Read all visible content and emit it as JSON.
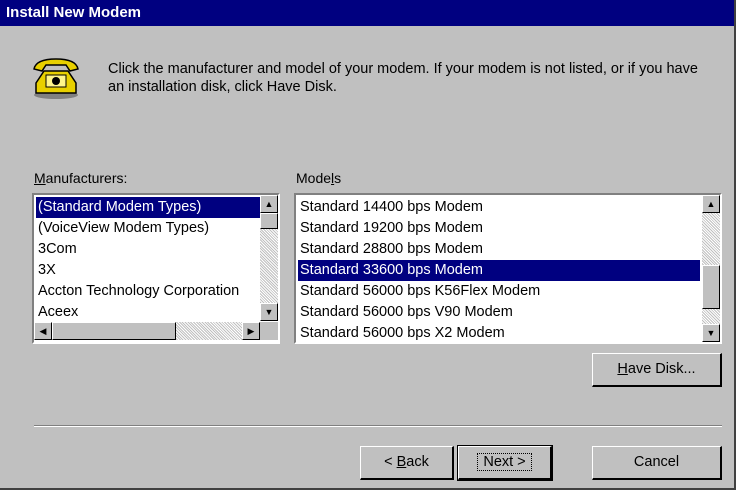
{
  "window": {
    "title": "Install New Modem"
  },
  "instruction": "Click the manufacturer and model of your modem. If your modem is not listed, or if you have an installation disk, click Have Disk.",
  "manufacturers": {
    "label_prefix": "",
    "label_hotkey": "M",
    "label_rest": "anufacturers:",
    "items": [
      "(Standard Modem Types)",
      "(VoiceView Modem Types)",
      "3Com",
      "3X",
      "Accton Technology Corporation",
      "Aceex"
    ],
    "selected_index": 0
  },
  "models": {
    "label_prefix": "Mode",
    "label_hotkey": "l",
    "label_rest": "s",
    "items": [
      "Standard 14400 bps Modem",
      "Standard 19200 bps Modem",
      "Standard 28800 bps Modem",
      "Standard 33600 bps Modem",
      "Standard 56000 bps K56Flex Modem",
      "Standard 56000 bps V90 Modem",
      "Standard 56000 bps X2 Modem"
    ],
    "selected_index": 3
  },
  "buttons": {
    "have_disk_hotkey": "H",
    "have_disk_rest": "ave Disk...",
    "back_prefix": "< ",
    "back_hotkey": "B",
    "back_rest": "ack",
    "next": "Next >",
    "cancel": "Cancel"
  },
  "icon": "telephone-icon"
}
